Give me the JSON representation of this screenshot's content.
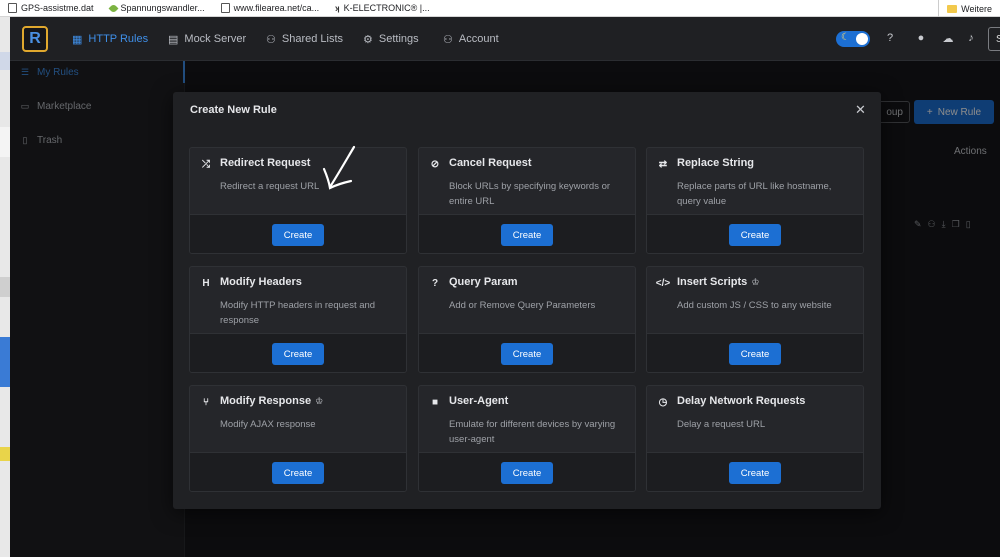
{
  "bookmarks": [
    {
      "label": "GPS-assistme.dat",
      "icon": "file-icon"
    },
    {
      "label": "Spannungswandler...",
      "icon": "leaf-icon"
    },
    {
      "label": "www.filearea.net/ca...",
      "icon": "file-icon"
    },
    {
      "label": "K-ELECTRONIC® |...",
      "icon": "k-logo-icon"
    }
  ],
  "bookmarks_right": {
    "label": "Weitere",
    "icon": "folder-icon"
  },
  "app": {
    "logo_letter": "R"
  },
  "nav": [
    {
      "label": "HTTP Rules",
      "icon": "http-rules-icon",
      "active": true
    },
    {
      "label": "Mock Server",
      "icon": "mock-server-icon",
      "active": false
    },
    {
      "label": "Shared Lists",
      "icon": "shared-lists-icon",
      "active": false
    },
    {
      "label": "Settings",
      "icon": "gear-icon",
      "active": false
    },
    {
      "label": "Account",
      "icon": "account-icon",
      "active": false
    }
  ],
  "topbar_right": {
    "edge_button": "S"
  },
  "sidebar": [
    {
      "label": "My Rules",
      "icon": "list-icon",
      "active": true
    },
    {
      "label": "Marketplace",
      "icon": "marketplace-icon",
      "active": false
    },
    {
      "label": "Trash",
      "icon": "trash-icon",
      "active": false
    }
  ],
  "background": {
    "group_button": "oup",
    "new_rule_button": "New Rule",
    "actions_header": "Actions"
  },
  "modal": {
    "title": "Create New Rule",
    "cards": [
      {
        "title": "Redirect Request",
        "description": "Redirect a request URL",
        "button": "Create",
        "icon": "shuffle-icon",
        "premium": false
      },
      {
        "title": "Cancel Request",
        "description": "Block URLs by specifying keywords or entire URL",
        "button": "Create",
        "icon": "block-icon",
        "premium": false
      },
      {
        "title": "Replace String",
        "description": "Replace parts of URL like hostname, query value",
        "button": "Create",
        "icon": "swap-icon",
        "premium": false
      },
      {
        "title": "Modify Headers",
        "description": "Modify HTTP headers in request and response",
        "button": "Create",
        "icon": "header-icon",
        "premium": false
      },
      {
        "title": "Query Param",
        "description": "Add or Remove Query Parameters",
        "button": "Create",
        "icon": "question-icon",
        "premium": false
      },
      {
        "title": "Insert Scripts",
        "description": "Add custom JS / CSS to any website",
        "button": "Create",
        "icon": "code-icon",
        "premium": true
      },
      {
        "title": "Modify Response",
        "description": "Modify AJAX response",
        "button": "Create",
        "icon": "branch-icon",
        "premium": true
      },
      {
        "title": "User-Agent",
        "description": "Emulate for different devices by varying user-agent",
        "button": "Create",
        "icon": "tablet-icon",
        "premium": false
      },
      {
        "title": "Delay Network Requests",
        "description": "Delay a request URL",
        "button": "Create",
        "icon": "clock-icon",
        "premium": false
      }
    ]
  },
  "colors": {
    "accent": "#1c6fd3",
    "active_nav": "#3f8fe8",
    "logo_border": "#e0a82e"
  }
}
